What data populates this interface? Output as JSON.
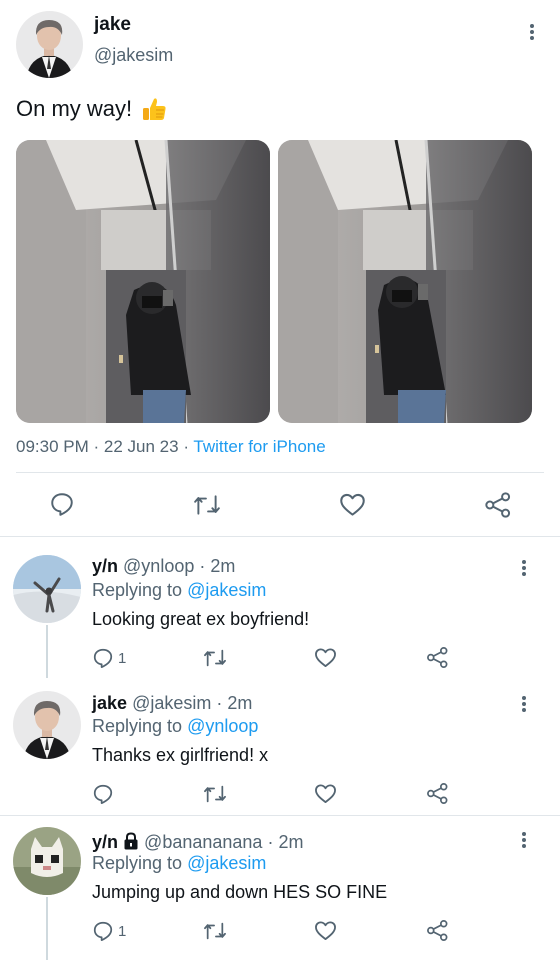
{
  "main_tweet": {
    "name": "jake",
    "handle": "@jakesim",
    "text": "On my way!",
    "emoji_icon": "thumbs-up-icon",
    "time": "09:30 PM",
    "sep1": "·",
    "date": "22 Jun 23",
    "sep2": "·",
    "source": "Twitter for iPhone",
    "photos": [
      "mirror-selfie-elevator",
      "mirror-selfie-elevator"
    ]
  },
  "actions": [
    "reply-icon",
    "retweet-icon",
    "like-icon",
    "share-icon"
  ],
  "replies": [
    {
      "name": "y/n",
      "handle": "@ynloop",
      "dot": "·",
      "time": "2m",
      "replying_label": "Replying to",
      "replying_to": "@jakesim",
      "text": "Looking great ex boyfriend!",
      "reply_count": "1"
    },
    {
      "name": "jake",
      "handle": "@jakesim",
      "dot": "·",
      "time": "2m",
      "replying_label": "Replying to",
      "replying_to": "@ynloop",
      "text": "Thanks ex girlfriend! x",
      "reply_count": ""
    },
    {
      "name": "y/n",
      "handle": "@banananana",
      "dot": "·",
      "time": "2m",
      "replying_label": "Replying to",
      "replying_to": "@jakesim",
      "text": "Jumping up and down HES SO FINE",
      "reply_count": "1",
      "locked": true
    }
  ],
  "colors": {
    "text": "#0f1419",
    "secondary": "#536471",
    "accent": "#1d9bf0",
    "divider": "#e1e6ea"
  }
}
